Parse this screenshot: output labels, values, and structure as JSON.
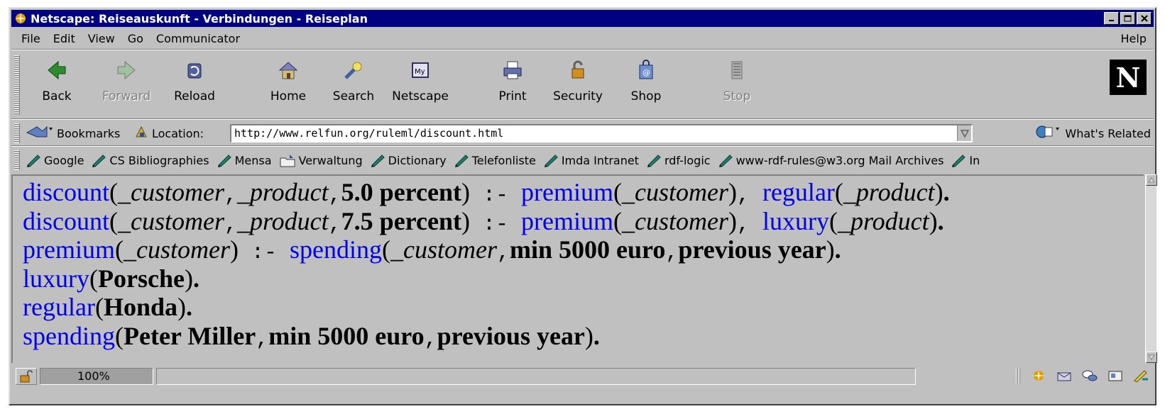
{
  "window": {
    "title": "Netscape: Reiseauskunft - Verbindungen - Reiseplan"
  },
  "menubar": {
    "items": [
      "File",
      "Edit",
      "View",
      "Go",
      "Communicator"
    ],
    "help": "Help"
  },
  "navbar": {
    "buttons": [
      {
        "label": "Back",
        "icon": "back-arrow-icon",
        "enabled": true
      },
      {
        "label": "Forward",
        "icon": "forward-arrow-icon",
        "enabled": false
      },
      {
        "label": "Reload",
        "icon": "reload-icon",
        "enabled": true
      },
      {
        "label": "Home",
        "icon": "home-icon",
        "enabled": true
      },
      {
        "label": "Search",
        "icon": "search-icon",
        "enabled": true
      },
      {
        "label": "Netscape",
        "icon": "my-netscape-icon",
        "enabled": true
      },
      {
        "label": "Print",
        "icon": "printer-icon",
        "enabled": true
      },
      {
        "label": "Security",
        "icon": "lock-icon",
        "enabled": true
      },
      {
        "label": "Shop",
        "icon": "shopping-bag-icon",
        "enabled": true
      },
      {
        "label": "Stop",
        "icon": "stop-icon",
        "enabled": false
      }
    ],
    "logo_letter": "N"
  },
  "locationbar": {
    "bookmarks_label": "Bookmarks",
    "location_label": "Location:",
    "url": "http://www.relfun.org/ruleml/discount.html",
    "whats_related_label": "What's Related"
  },
  "personalbar": {
    "items": [
      "Google",
      "CS Bibliographies",
      "Mensa",
      "Verwaltung",
      "Dictionary",
      "Telefonliste",
      "Imda Intranet",
      "rdf-logic",
      "www-rdf-rules@w3.org Mail Archives",
      "In"
    ]
  },
  "content": {
    "lines": {
      "l1": {
        "pred": "discount",
        "v1": "_customer",
        "v2": "_product",
        "c1": "5.0 percent",
        "imp": ":-",
        "p2": "premium",
        "v3": "_customer",
        "p3": "regular",
        "v4": "_product"
      },
      "l2": {
        "pred": "discount",
        "v1": "_customer",
        "v2": "_product",
        "c1": "7.5 percent",
        "imp": ":-",
        "p2": "premium",
        "v3": "_customer",
        "p3": "luxury",
        "v4": "_product"
      },
      "l3": {
        "pred": "premium",
        "v1": "_customer",
        "imp": ":-",
        "p2": "spending",
        "v2": "_customer",
        "c1": "min 5000 euro",
        "c2": "previous year"
      },
      "l4": {
        "pred": "luxury",
        "c1": "Porsche"
      },
      "l5": {
        "pred": "regular",
        "c1": "Honda"
      },
      "l6": {
        "pred": "spending",
        "c1": "Peter Miller",
        "c2": "min 5000 euro",
        "c3": "previous year"
      }
    }
  },
  "statusbar": {
    "zoom": "100%"
  },
  "colors": {
    "titlebar": "#000080",
    "chrome": "#c0c0c0",
    "predicate": "#0000ee"
  }
}
